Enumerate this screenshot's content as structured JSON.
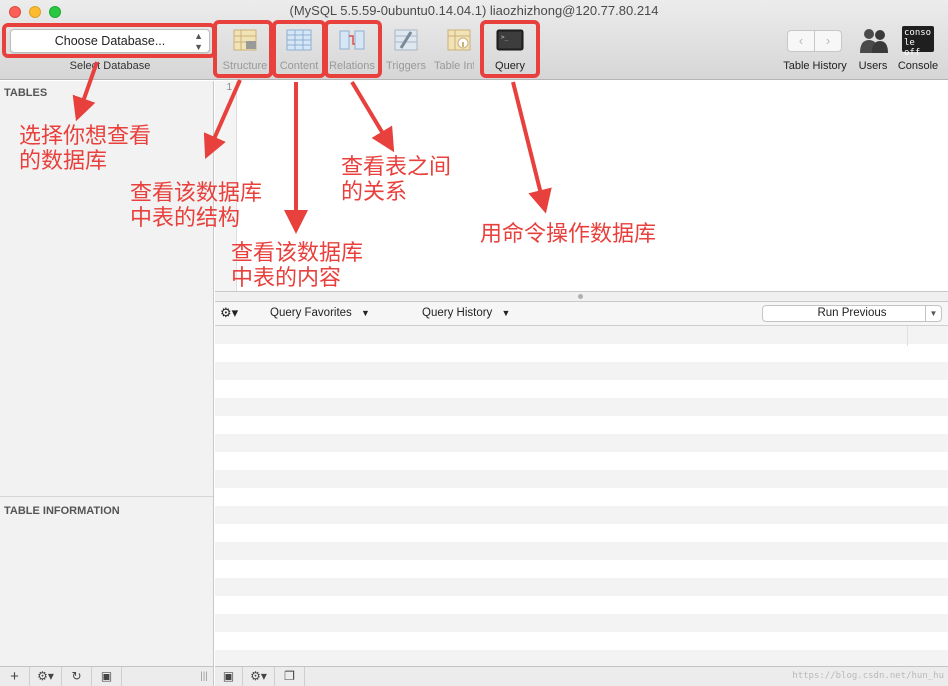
{
  "window": {
    "title": "(MySQL 5.5.59-0ubuntu0.14.04.1) liaozhizhong@120.77.80.214"
  },
  "toolbar": {
    "database_select": {
      "value": "Choose Database...",
      "caption": "Select Database"
    },
    "tabs": [
      {
        "label": "Structure",
        "icon": "structure-icon",
        "active": false
      },
      {
        "label": "Content",
        "icon": "content-icon",
        "active": false
      },
      {
        "label": "Relations",
        "icon": "relations-icon",
        "active": false
      },
      {
        "label": "Triggers",
        "icon": "triggers-icon",
        "active": false
      },
      {
        "label": "Table Info",
        "icon": "table-info-icon",
        "active": false
      },
      {
        "label": "Query",
        "icon": "query-terminal-icon",
        "active": true
      }
    ],
    "right": [
      {
        "label": "Table History",
        "icon": "back-forward-icon"
      },
      {
        "label": "Users",
        "icon": "users-icon"
      },
      {
        "label": "Console",
        "icon": "console-icon",
        "badge_top": "conso",
        "badge_bottom": "le off"
      }
    ]
  },
  "sidebar": {
    "tables_header": "TABLES",
    "info_header": "TABLE INFORMATION"
  },
  "editor": {
    "line_numbers": [
      "1"
    ]
  },
  "query_bar": {
    "favorites": "Query Favorites",
    "history": "Query History",
    "run_previous": "Run Previous"
  },
  "annotations": [
    {
      "text": "选择你想查看\n的数据库",
      "line1": "选择你想查看",
      "line2": "的数据库"
    },
    {
      "text": "查看该数据库\n中表的结构",
      "line1": "查看该数据库",
      "line2": "中表的结构"
    },
    {
      "text": "查看该数据库\n中表的内容",
      "line1": "查看该数据库",
      "line2": "中表的内容"
    },
    {
      "text": "查看表之间\n的关系",
      "line1": "查看表之间",
      "line2": "的关系"
    },
    {
      "text": "用命令操作数据库",
      "line1": "用命令操作数据库"
    }
  ],
  "watermark": "https://blog.csdn.net/hun_hu",
  "colors": {
    "annotation": "#e8403c",
    "accent_close": "#fc5f57",
    "accent_min": "#fdbc2e",
    "accent_max": "#29c840"
  }
}
